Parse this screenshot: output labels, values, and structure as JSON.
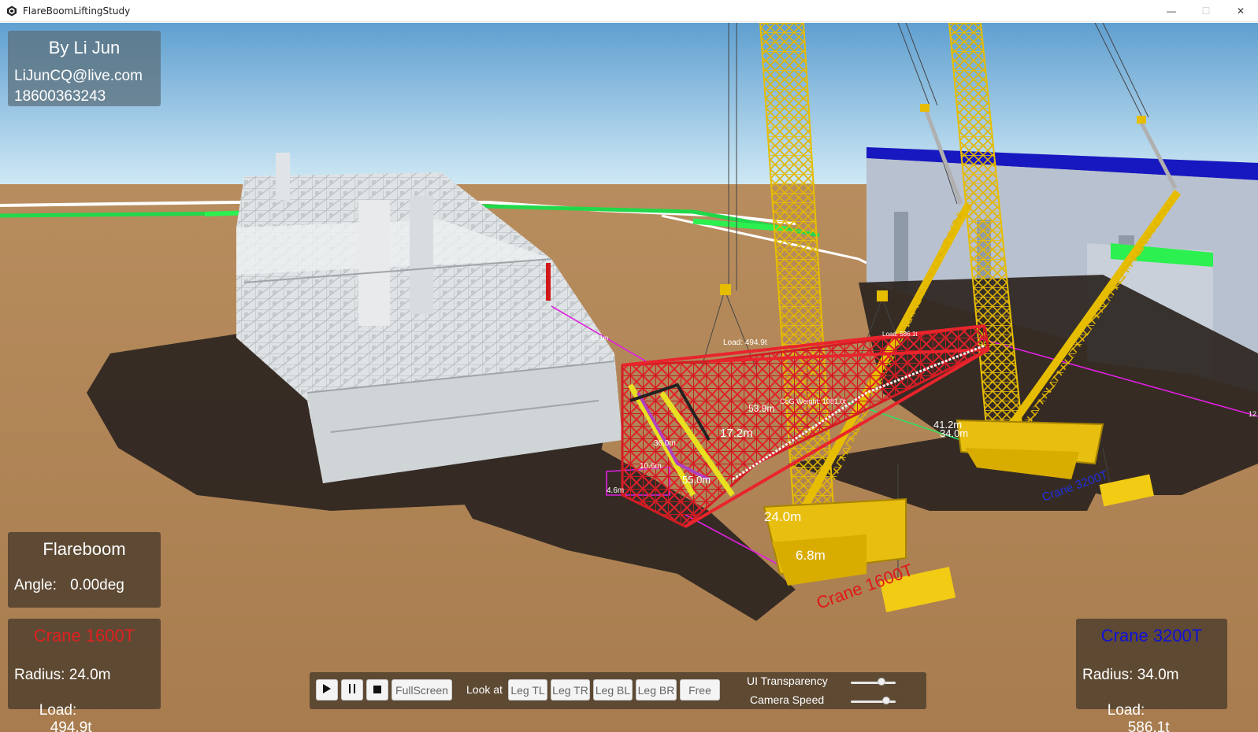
{
  "window": {
    "title": "FlareBoomLiftingStudy",
    "minimize_glyph": "—",
    "maximize_glyph": "☐",
    "close_glyph": "✕"
  },
  "author": {
    "name": "By Li Jun",
    "email": "LiJunCQ@live.com",
    "phone": "18600363243"
  },
  "flareboom": {
    "title": "Flareboom",
    "angle_label": "Angle:",
    "angle_value": "0.00deg"
  },
  "crane1": {
    "title": "Crane 1600T",
    "title_color": "#e02020",
    "radius_text": "Radius: 24.0m",
    "load_label": "Load:",
    "load_value": "494.9t"
  },
  "crane2": {
    "title": "Crane 3200T",
    "title_color": "#1010d8",
    "radius_text": "Radius: 34.0m",
    "load_label": "Load:",
    "load_value": "586.1t"
  },
  "toolbar": {
    "play_icon": "play-icon",
    "pause_icon": "pause-icon",
    "stop_icon": "stop-icon",
    "fullscreen_label": "FullScreen",
    "look_at_label": "Look at",
    "look_buttons": [
      "Leg TL",
      "Leg TR",
      "Leg BL",
      "Leg BR",
      "Free"
    ],
    "ui_transparency_label": "UI Transparency",
    "camera_speed_label": "Camera Speed",
    "ui_transparency_value": 0.72,
    "camera_speed_value": 0.85
  },
  "scene_labels": {
    "load_1600": "Load: 494.9t",
    "load_3200": "Load: 586.1t",
    "crane_1600_ground": "Crane 1600T",
    "crane_3200_ground": "Crane 3200T",
    "cog_weight": "CoG Weight: 1081.0t",
    "dim_48": "48.1m",
    "dim_539": "53.9m",
    "dim_172": "17.2m",
    "dim_360": "36.0m",
    "dim_106": "10.6m",
    "dim_46": "4.6m",
    "dim_550": "55.0m",
    "dim_240": "24.0m",
    "dim_68": "6.8m",
    "dim_412": "41.2m",
    "dim_340": "34.0m",
    "dim_12": "12"
  }
}
